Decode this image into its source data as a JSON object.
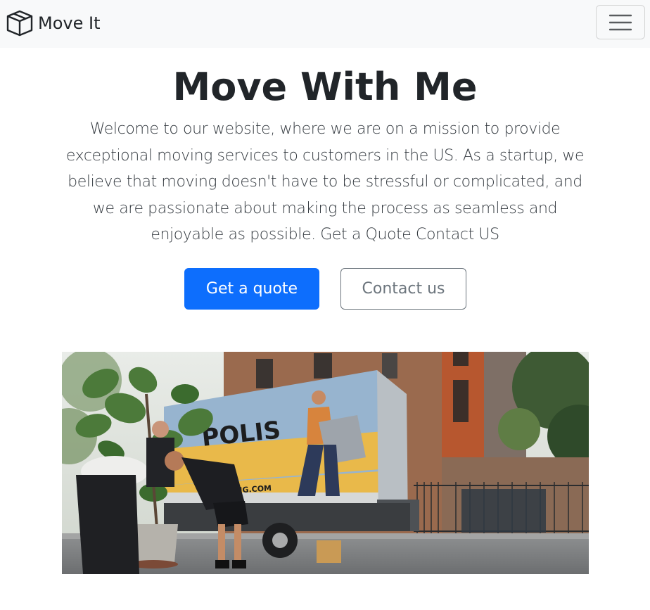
{
  "navbar": {
    "brand": "Move It",
    "brand_icon": "box-icon",
    "toggler_icon": "hamburger-menu-icon",
    "background": "#f8f9fa"
  },
  "hero": {
    "title": "Move With Me",
    "lead": "Welcome to our website, where we are on a mission to provide exceptional moving services to customers in the US. As a startup, we believe that moving doesn't have to be stressful or complicated, and we are passionate about making the process as seamless and enjoyable as possible. Get a Quote Contact US",
    "primary_button": "Get a quote",
    "secondary_button": "Contact us"
  },
  "image": {
    "truck_lettering": "POLIS",
    "truck_website": "MOVING.COM"
  },
  "colors": {
    "primary": "#0d6efd",
    "secondary": "#6c757d",
    "text": "#212529"
  }
}
